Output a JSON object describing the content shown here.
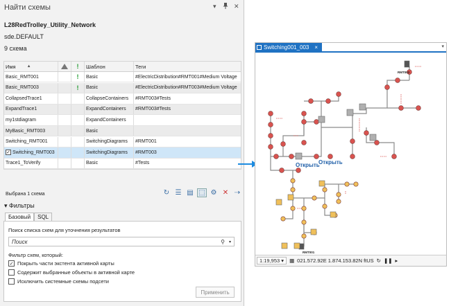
{
  "pane": {
    "title": "Найти схемы",
    "pin_icon": "▾",
    "pin2_icon": "📌",
    "close_icon": "✕",
    "network": "L28RedTrolley_Utility_Network",
    "version": "sde.DEFAULT",
    "count": "9 схема"
  },
  "grid": {
    "headers": {
      "name": "Имя",
      "template": "Шаблон",
      "tags": "Теги"
    },
    "rows": [
      {
        "name": "Basic_RMT001",
        "flag": "!",
        "template": "Basic",
        "tags": "#ElectricDistribution#RMT001#Medium Voltage"
      },
      {
        "name": "Basic_RMT003",
        "flag": "!",
        "template": "Basic",
        "tags": "#ElectricDistribution#RMT003#Medium Voltage"
      },
      {
        "name": "CollapsedTrace1",
        "flag": "",
        "template": "CollapseContainers",
        "tags": "#RMT003#Tests"
      },
      {
        "name": "ExpandTrace1",
        "flag": "",
        "template": "ExpandContainers",
        "tags": "#RMT003#Tests"
      },
      {
        "name": "my1stdiagram",
        "flag": "",
        "template": "ExpandContainers",
        "tags": ""
      },
      {
        "name": "MyBasic_RMT003",
        "flag": "",
        "template": "Basic",
        "tags": ""
      },
      {
        "name": "Switching_RMT001",
        "flag": "",
        "template": "SwitchingDiagrams",
        "tags": "#RMT001"
      },
      {
        "name": "Switching_RMT003",
        "flag": "",
        "template": "SwitchingDiagrams",
        "tags": "#RMT003"
      },
      {
        "name": "Trace1_ToVerify",
        "flag": "",
        "template": "Basic",
        "tags": "#Tests"
      }
    ]
  },
  "selection_status": "Выбрана 1 схема",
  "filters": {
    "header": "Фильтры",
    "tabs": [
      "Базовый",
      "SQL"
    ],
    "search_label": "Поиск списка схем для уточнения результатов",
    "search_placeholder": "Поиск",
    "filter_label": "Фильтр схем, который:",
    "options": [
      {
        "label": "Покрыть части экстента активной карты",
        "checked": true
      },
      {
        "label": "Содержит выбранные объекты в активной карте",
        "checked": false
      },
      {
        "label": "Исключить системные схемы подсети",
        "checked": false
      }
    ],
    "apply": "Применить"
  },
  "map": {
    "tab_title": "Switching001_003",
    "tab_close": "×",
    "open_label": "Открыть",
    "scale": "1:19,953",
    "coords": "021.572.92E 1.874.153.82N ftUS",
    "label_top": "RMT003",
    "label_bottom": "RMT001"
  },
  "colors": {
    "accent": "#1f72c3",
    "selected_row": "#cfe6f8",
    "red_node": "#d9534f",
    "yellow_node": "#f0c05a"
  }
}
